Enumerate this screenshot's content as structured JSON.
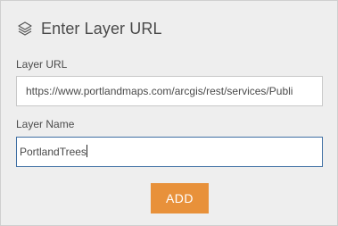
{
  "dialog": {
    "icon": "layers-icon",
    "title": "Enter Layer URL"
  },
  "form": {
    "url_label": "Layer URL",
    "url_value": "https://www.portlandmaps.com/arcgis/rest/services/Publi",
    "name_label": "Layer Name",
    "name_value": "PortlandTrees"
  },
  "actions": {
    "add_label": "ADD"
  },
  "colors": {
    "accent_button": "#e8913a",
    "panel_background": "#eeeeee",
    "focus_border": "#3f6fa3"
  }
}
